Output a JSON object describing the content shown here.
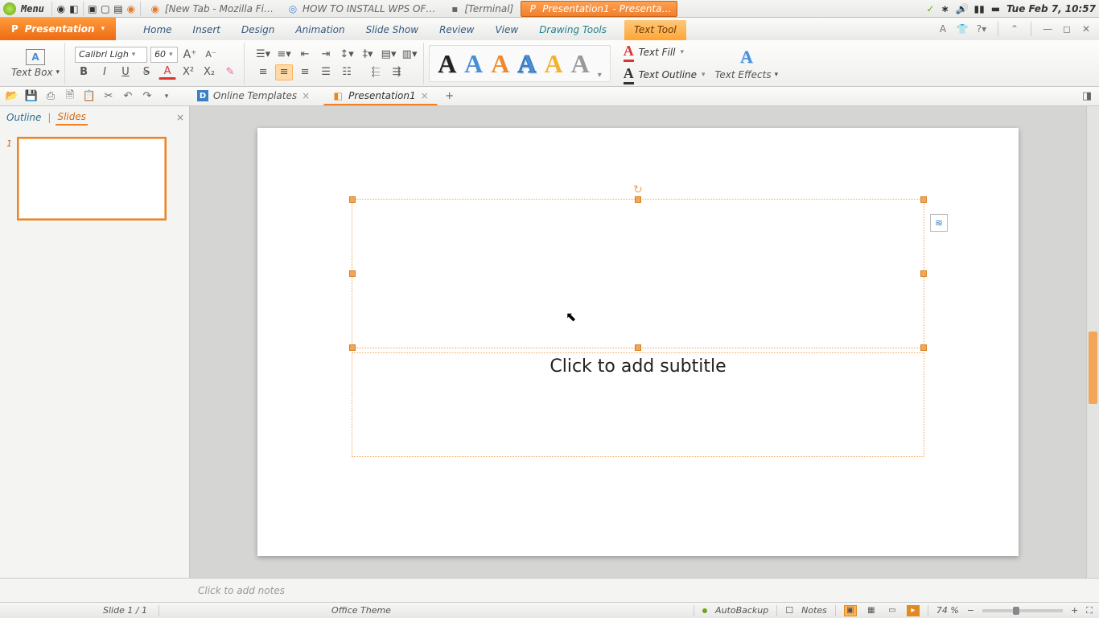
{
  "system": {
    "menu_label": "Menu",
    "tasks": [
      {
        "label": "[New Tab - Mozilla Fi…",
        "icon": "firefox"
      },
      {
        "label": "HOW TO INSTALL WPS OF…",
        "icon": "chromium"
      },
      {
        "label": "[Terminal]",
        "icon": "terminal"
      },
      {
        "label": "Presentation1 - Presenta…",
        "icon": "wps",
        "active": true
      }
    ],
    "clock": "Tue Feb  7, 10:57"
  },
  "app": {
    "name": "Presentation",
    "menus": [
      "Home",
      "Insert",
      "Design",
      "Animation",
      "Slide Show",
      "Review",
      "View"
    ],
    "context_menus": [
      "Drawing Tools",
      "Text Tool"
    ],
    "active_menu": "Text Tool"
  },
  "ribbon": {
    "textbox_label": "Text Box",
    "font_name": "Calibri Ligh",
    "font_size": "60",
    "text_fill": "Text Fill",
    "text_outline": "Text Outline",
    "text_effects": "Text Effects"
  },
  "doctabs": {
    "online_templates": "Online Templates",
    "presentation": "Presentation1"
  },
  "side": {
    "outline": "Outline",
    "slides": "Slides",
    "thumb_num": "1"
  },
  "slide": {
    "subtitle_placeholder": "Click to add subtitle"
  },
  "notes": {
    "placeholder": "Click to add notes"
  },
  "status": {
    "slide_info": "Slide 1 / 1",
    "theme": "Office Theme",
    "autobackup": "AutoBackup",
    "notes": "Notes",
    "zoom": "74 %"
  }
}
